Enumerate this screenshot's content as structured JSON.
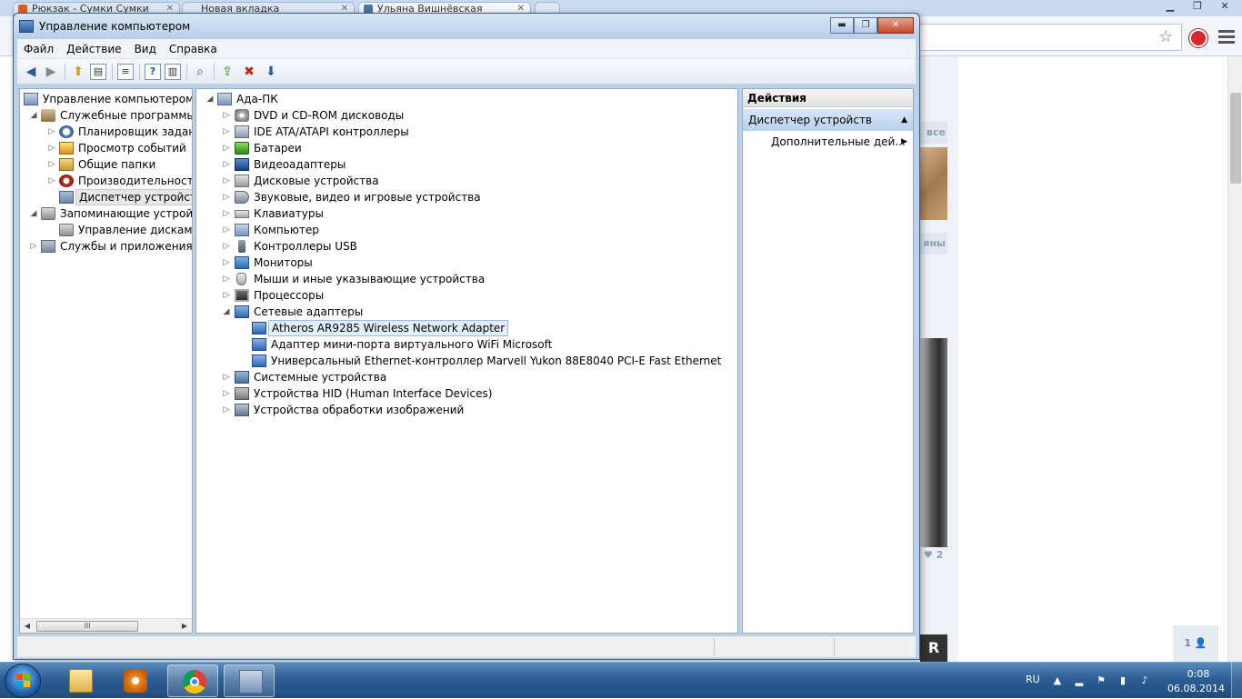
{
  "browser": {
    "tabs": [
      {
        "label": "Рюкзак - Сумки Сумки"
      },
      {
        "label": "Новая вкладка"
      },
      {
        "label": "Ульяна Вишнёвская"
      }
    ],
    "page": {
      "tag_all": "все",
      "tag_second": "яны",
      "likes": "♥ 2",
      "friends_badge": "1 👤",
      "photo3_letter": "R"
    }
  },
  "window": {
    "title": "Управление компьютером",
    "controls": {
      "minimize": "▬",
      "maximize": "❐",
      "close": "✕"
    }
  },
  "menu": [
    "Файл",
    "Действие",
    "Вид",
    "Справка"
  ],
  "left_tree": [
    {
      "label": "Управление компьютером (л",
      "level": 0,
      "icon": "computer-management-icon",
      "expander": ""
    },
    {
      "label": "Служебные программы",
      "level": 1,
      "icon": "system-tools-icon",
      "expander": "◢"
    },
    {
      "label": "Планировщик заданий",
      "level": 2,
      "icon": "task-scheduler-icon",
      "expander": "▷"
    },
    {
      "label": "Просмотр событий",
      "level": 2,
      "icon": "event-viewer-icon",
      "expander": "▷"
    },
    {
      "label": "Общие папки",
      "level": 2,
      "icon": "shared-folders-icon",
      "expander": "▷"
    },
    {
      "label": "Производительность",
      "level": 2,
      "icon": "performance-icon",
      "expander": "▷"
    },
    {
      "label": "Диспетчер устройств",
      "level": 2,
      "icon": "device-manager-icon",
      "expander": "",
      "selected": true
    },
    {
      "label": "Запоминающие устройст",
      "level": 1,
      "icon": "storage-icon",
      "expander": "◢"
    },
    {
      "label": "Управление дисками",
      "level": 2,
      "icon": "disk-management-icon",
      "expander": ""
    },
    {
      "label": "Службы и приложения",
      "level": 1,
      "icon": "services-apps-icon",
      "expander": "▷"
    }
  ],
  "device_tree": {
    "root": "Ада-ПК",
    "categories": [
      {
        "label": "DVD и CD-ROM дисководы",
        "icon": "dvd-drive-icon"
      },
      {
        "label": "IDE ATA/ATAPI контроллеры",
        "icon": "ide-controller-icon"
      },
      {
        "label": "Батареи",
        "icon": "battery-icon"
      },
      {
        "label": "Видеоадаптеры",
        "icon": "display-adapter-icon"
      },
      {
        "label": "Дисковые устройства",
        "icon": "disk-drive-icon"
      },
      {
        "label": "Звуковые, видео и игровые устройства",
        "icon": "sound-device-icon"
      },
      {
        "label": "Клавиатуры",
        "icon": "keyboard-icon"
      },
      {
        "label": "Компьютер",
        "icon": "computer-icon"
      },
      {
        "label": "Контроллеры USB",
        "icon": "usb-controller-icon"
      },
      {
        "label": "Мониторы",
        "icon": "monitor-icon"
      },
      {
        "label": "Мыши и иные указывающие устройства",
        "icon": "mouse-icon"
      },
      {
        "label": "Процессоры",
        "icon": "processor-icon"
      },
      {
        "label": "Сетевые адаптеры",
        "icon": "network-adapter-icon",
        "expanded": true,
        "children": [
          {
            "label": "Atheros AR9285 Wireless Network Adapter",
            "selected": true
          },
          {
            "label": "Адаптер мини-порта виртуального WiFi Microsoft"
          },
          {
            "label": "Универсальный Ethernet-контроллер Marvell Yukon 88E8040 PCI-E Fast Ethernet"
          }
        ]
      },
      {
        "label": "Системные устройства",
        "icon": "system-device-icon"
      },
      {
        "label": "Устройства HID (Human Interface Devices)",
        "icon": "hid-icon"
      },
      {
        "label": "Устройства обработки изображений",
        "icon": "imaging-device-icon"
      }
    ]
  },
  "actions": {
    "header": "Действия",
    "section": "Диспетчер устройств",
    "more": "Дополнительные дей..."
  },
  "taskbar": {
    "language": "RU",
    "time": "0:08",
    "date": "06.08.2014"
  }
}
